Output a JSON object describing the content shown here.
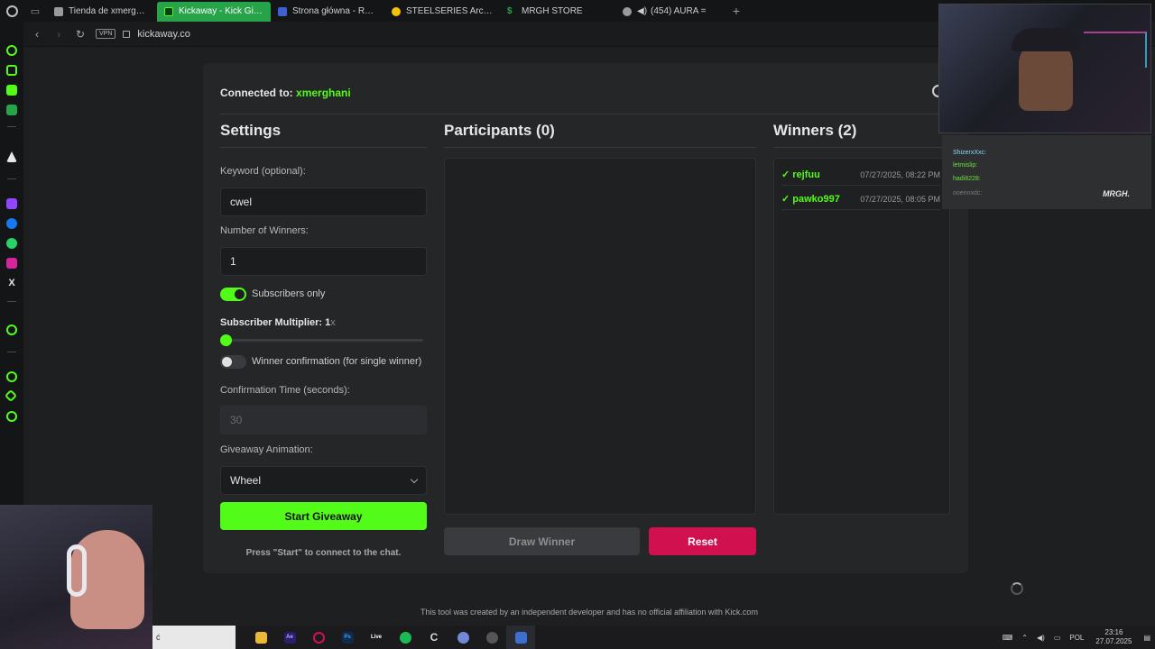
{
  "browser": {
    "tabs": [
      {
        "label": "Tienda de xmerghani | Tr",
        "active": false,
        "color": "#9a9a9a"
      },
      {
        "label": "Kickaway - Kick Giveaw",
        "active": true,
        "color": "#53fc18"
      },
      {
        "label": "Strona główna - Roblox",
        "active": false,
        "color": "#3d5fd0"
      },
      {
        "label": "STEELSERIES Arctis Nov",
        "active": false,
        "color": "#f4c20d"
      },
      {
        "label": "MRGH STORE",
        "active": false,
        "color": "#27a34a"
      },
      {
        "label": "(454) AURA = ",
        "active": false,
        "color": "#9a9a9a"
      }
    ],
    "vpn_label": "VPN",
    "url": "kickaway.co"
  },
  "app": {
    "connected_label": "Connected to:",
    "connected_user": "xmerghani",
    "settings": {
      "title": "Settings",
      "keyword_label": "Keyword (optional):",
      "keyword_value": "cwel",
      "winners_label": "Number of Winners:",
      "winners_value": "1",
      "subscribers_only_label": "Subscribers only",
      "subscribers_only": true,
      "multiplier_label": "Subscriber Multiplier: 1",
      "multiplier_suffix": "x",
      "multiplier_level": 0.0,
      "confirmation_label": "Winner confirmation (for single winner)",
      "confirmation_enabled": false,
      "confirmation_time_label": "Confirmation Time (seconds):",
      "confirmation_time_value": "30",
      "animation_label": "Giveaway Animation:",
      "animation_value": "Wheel",
      "start_button": "Start Giveaway",
      "hint": "Press \"Start\" to connect to the chat."
    },
    "participants": {
      "title": "Participants (0)",
      "draw_button": "Draw Winner",
      "reset_button": "Reset"
    },
    "winners": {
      "title": "Winners (2)",
      "list": [
        {
          "name": "rejfuu",
          "date": "07/27/2025, 08:22 PM"
        },
        {
          "name": "pawko997",
          "date": "07/27/2025, 08:05 PM"
        }
      ]
    },
    "footer": "This tool was created by an independent developer and has no official affiliation with Kick.com",
    "accent_color": "#53fc18",
    "danger_color": "#d0104f"
  },
  "overlay": {
    "chat_lines": [
      "ShizerxXxc:",
      "letmislip:",
      "hadi8228:",
      "ooennxdc:"
    ],
    "brand": "MRGH."
  },
  "taskbar": {
    "search_text": "ć",
    "apps": [
      {
        "name": "file-explorer-icon",
        "label": "",
        "color": "#e8b836"
      },
      {
        "name": "after-effects-icon",
        "label": "Ae",
        "color": "#2a1f6e"
      },
      {
        "name": "opera-gx-icon",
        "label": "",
        "color": "#d0104f"
      },
      {
        "name": "photoshop-icon",
        "label": "Ps",
        "color": "#0f2a4a"
      },
      {
        "name": "live-icon",
        "label": "Live",
        "color": "#333333"
      },
      {
        "name": "spotify-icon",
        "label": "",
        "color": "#1db954"
      },
      {
        "name": "c-app-icon",
        "label": "C",
        "color": "#4a6fa5"
      },
      {
        "name": "discord-icon",
        "label": "",
        "color": "#7289da"
      },
      {
        "name": "obs-icon",
        "label": "",
        "color": "#555555"
      },
      {
        "name": "roblox-studio-icon",
        "label": "",
        "color": "#3d6fd0"
      }
    ],
    "language": "POL",
    "time": "23:16",
    "date": "27.07.2025"
  }
}
